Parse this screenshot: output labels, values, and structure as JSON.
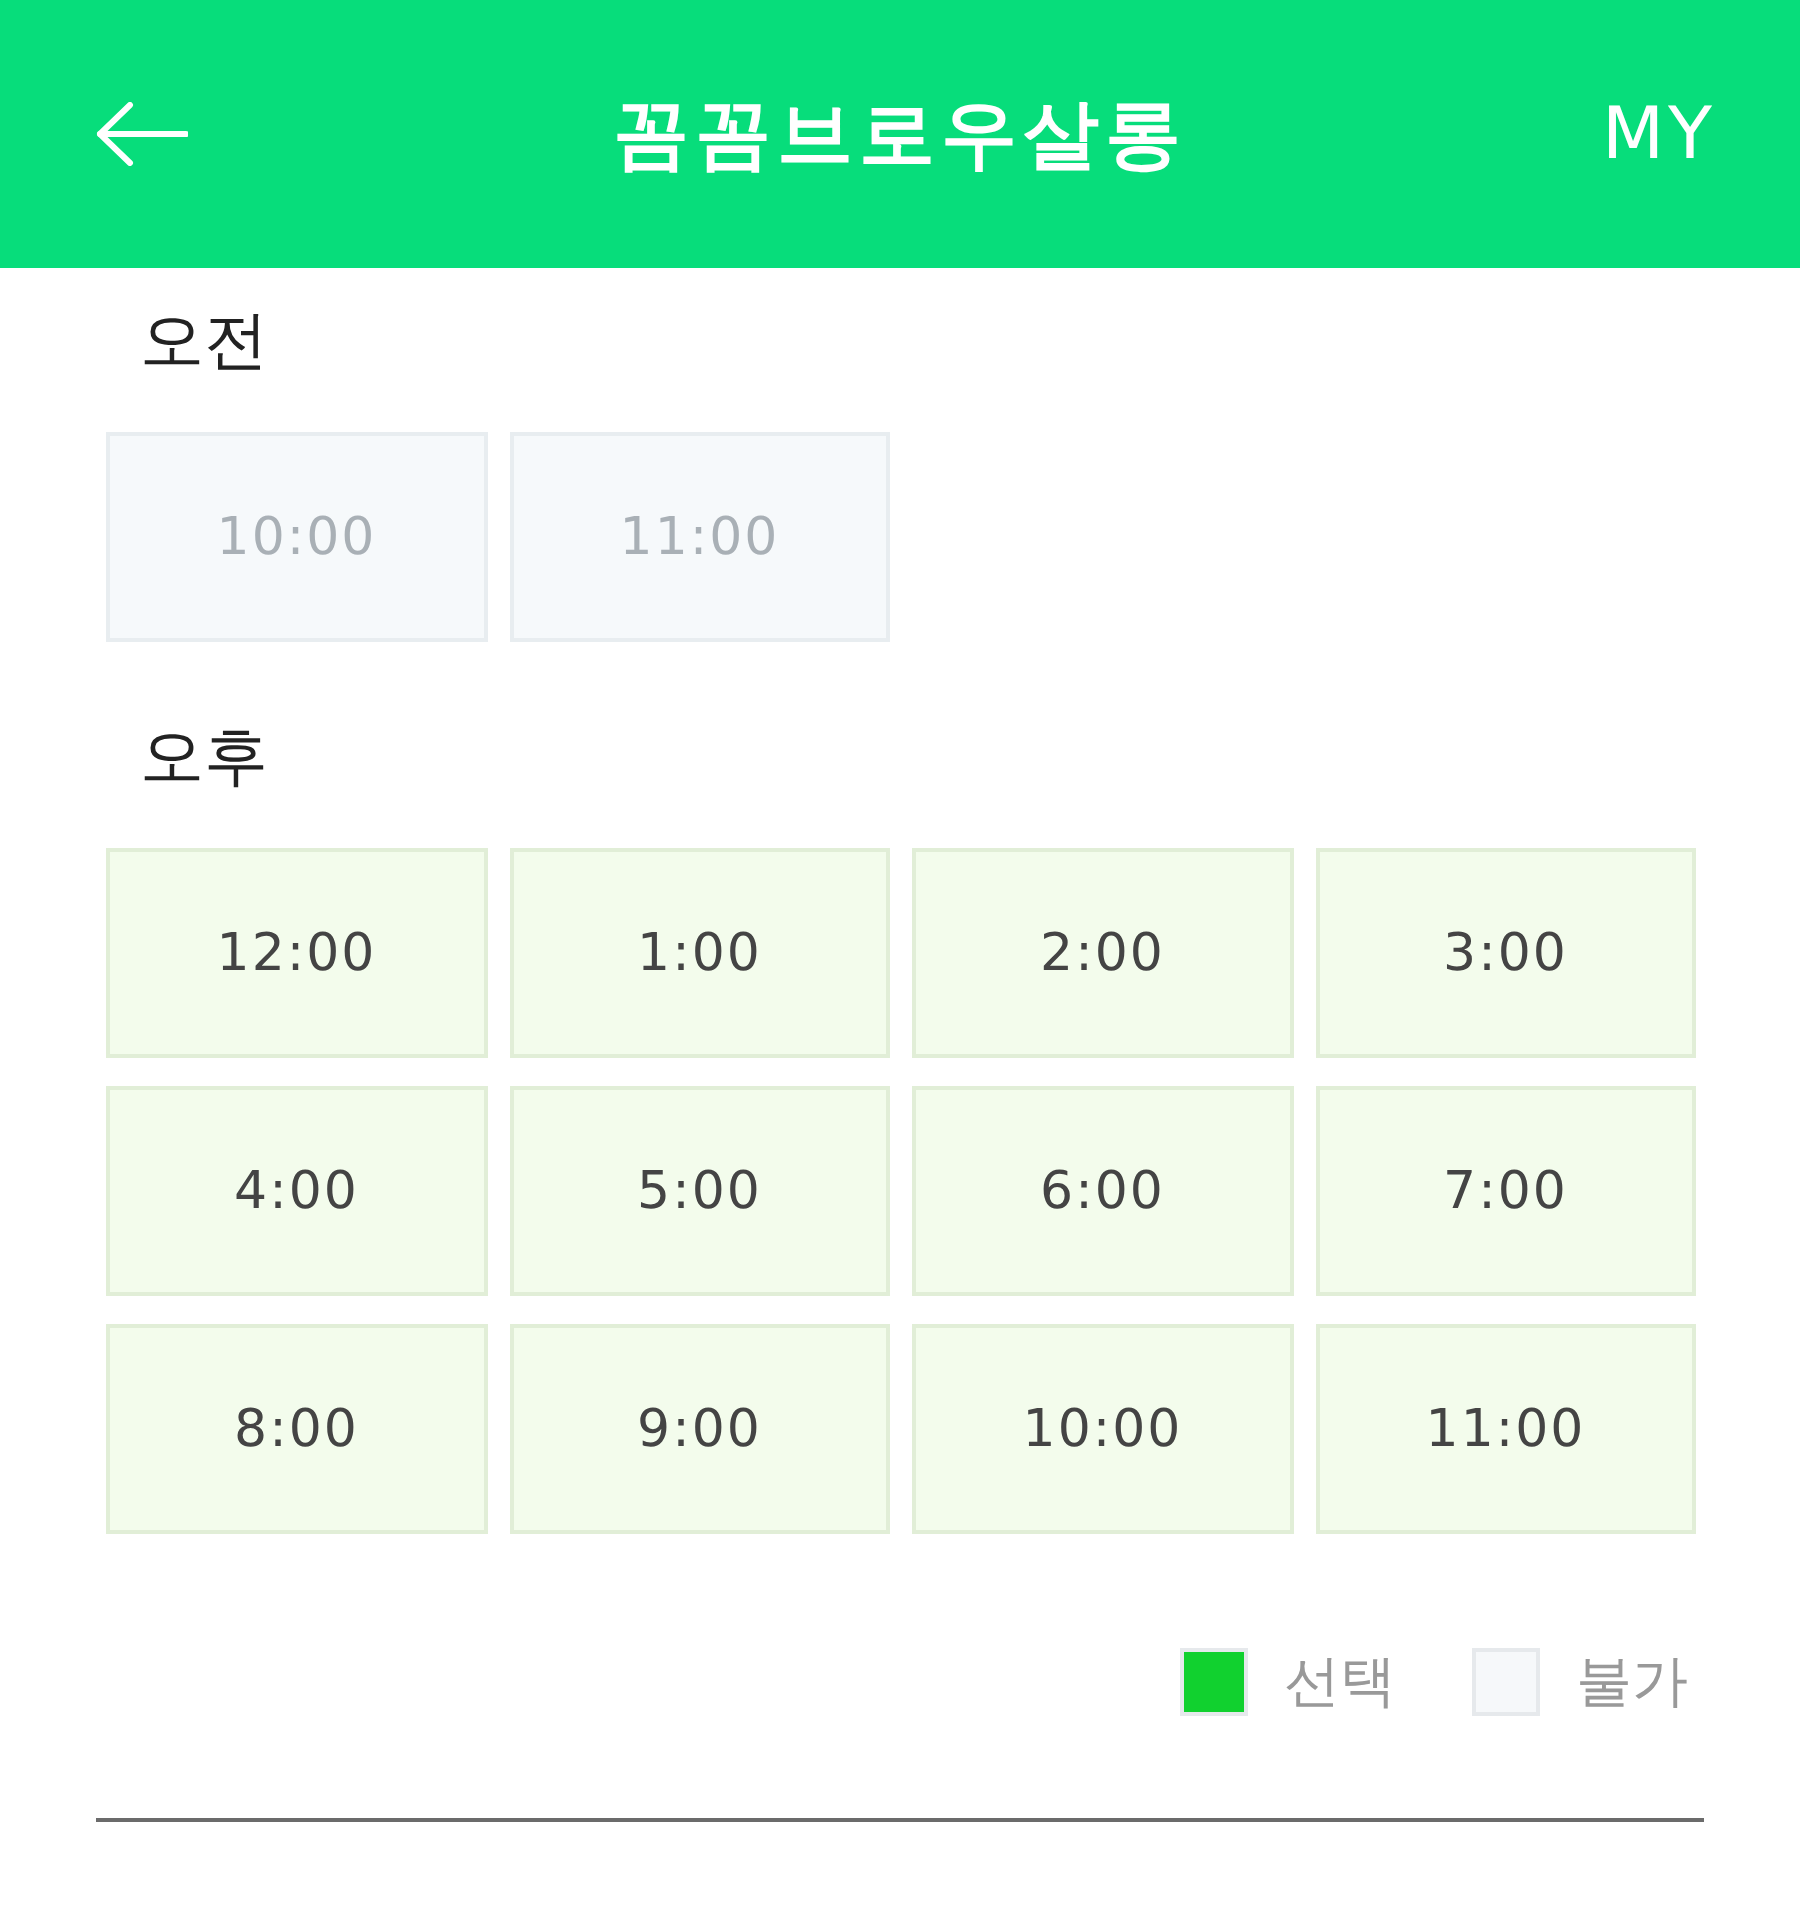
{
  "header": {
    "title": "꼼꼼브로우살롱",
    "my_label": "MY"
  },
  "sections": [
    {
      "label": "오전",
      "slots": [
        {
          "time": "10:00",
          "disabled": true
        },
        {
          "time": "11:00",
          "disabled": true
        }
      ]
    },
    {
      "label": "오후",
      "slots": [
        {
          "time": "12:00",
          "disabled": false
        },
        {
          "time": "1:00",
          "disabled": false
        },
        {
          "time": "2:00",
          "disabled": false
        },
        {
          "time": "3:00",
          "disabled": false
        },
        {
          "time": "4:00",
          "disabled": false
        },
        {
          "time": "5:00",
          "disabled": false
        },
        {
          "time": "6:00",
          "disabled": false
        },
        {
          "time": "7:00",
          "disabled": false
        },
        {
          "time": "8:00",
          "disabled": false
        },
        {
          "time": "9:00",
          "disabled": false
        },
        {
          "time": "10:00",
          "disabled": false
        },
        {
          "time": "11:00",
          "disabled": false
        }
      ]
    }
  ],
  "legend": [
    {
      "label": "선택",
      "color": "#11d12f"
    },
    {
      "label": "불가",
      "color": "#f6f8fa"
    }
  ]
}
